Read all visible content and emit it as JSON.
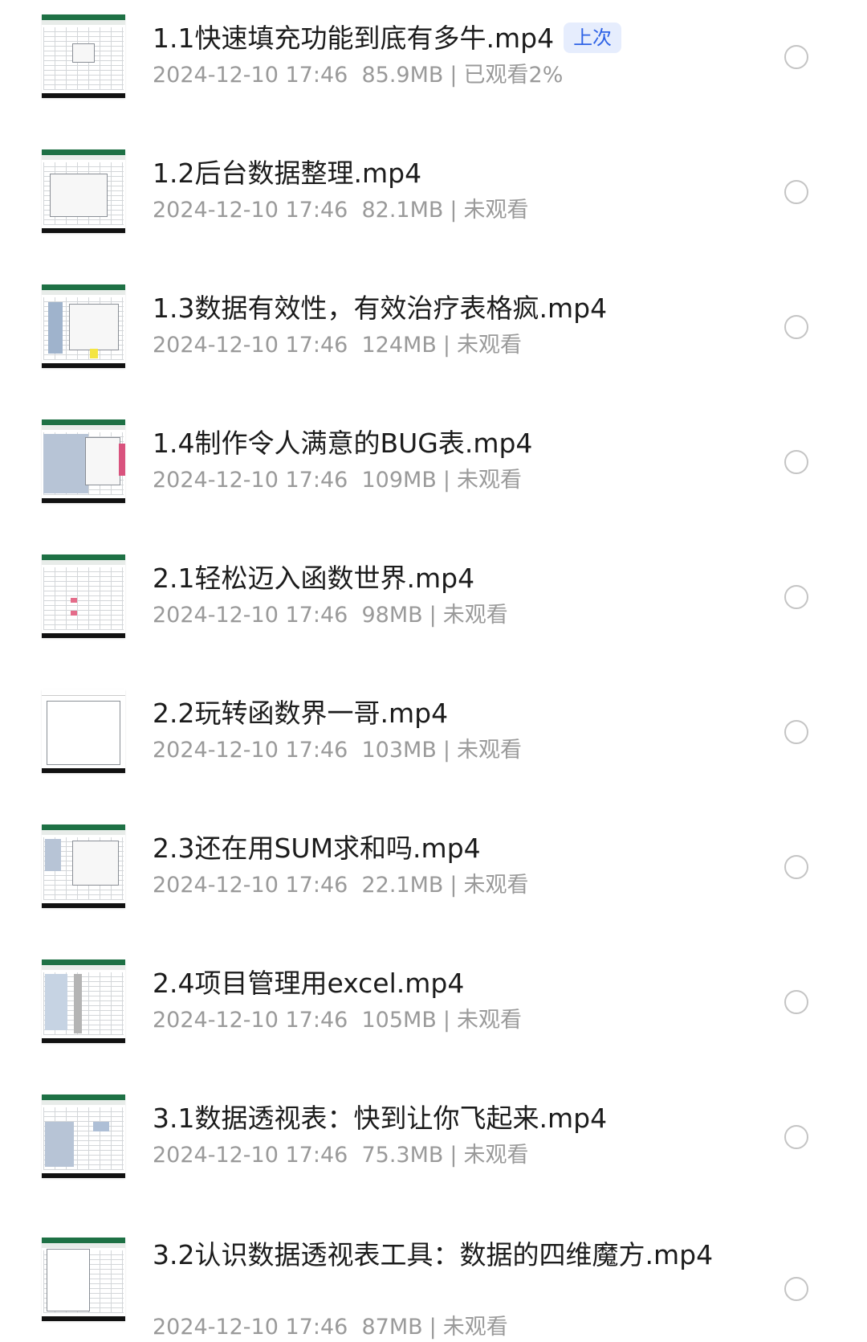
{
  "items": [
    {
      "title": "1.1快速填充功能到底有多牛.mp4",
      "badge": "上次",
      "date": "2024-12-10 17:46",
      "size": "85.9MB",
      "sep": "|",
      "status": "已观看2%"
    },
    {
      "title": "1.2后台数据整理.mp4",
      "date": "2024-12-10 17:46",
      "size": "82.1MB",
      "sep": "|",
      "status": "未观看"
    },
    {
      "title": "1.3数据有效性，有效治疗表格疯.mp4",
      "date": "2024-12-10 17:46",
      "size": "124MB",
      "sep": "|",
      "status": "未观看"
    },
    {
      "title": "1.4制作令人满意的BUG表.mp4",
      "date": "2024-12-10 17:46",
      "size": "109MB",
      "sep": "|",
      "status": "未观看"
    },
    {
      "title": "2.1轻松迈入函数世界.mp4",
      "date": "2024-12-10 17:46",
      "size": "98MB",
      "sep": "|",
      "status": "未观看"
    },
    {
      "title": "2.2玩转函数界一哥.mp4",
      "date": "2024-12-10 17:46",
      "size": "103MB",
      "sep": "|",
      "status": "未观看"
    },
    {
      "title": "2.3还在用SUM求和吗.mp4",
      "date": "2024-12-10 17:46",
      "size": "22.1MB",
      "sep": "|",
      "status": "未观看"
    },
    {
      "title": "2.4项目管理用excel.mp4",
      "date": "2024-12-10 17:46",
      "size": "105MB",
      "sep": "|",
      "status": "未观看"
    },
    {
      "title": "3.1数据透视表：快到让你飞起来.mp4",
      "date": "2024-12-10 17:46",
      "size": "75.3MB",
      "sep": "|",
      "status": "未观看"
    },
    {
      "title": "3.2认识数据透视表工具：数据的四维魔方.mp4",
      "date": "2024-12-10 17:46",
      "size": "87MB",
      "sep": "|",
      "status": "未观看"
    }
  ],
  "colors": {
    "badge_text": "#2f63e6",
    "badge_bg": "#e6edfd",
    "meta": "#9a9a9a",
    "excel_green": "#1e7145"
  },
  "icons": {
    "thumbnail": "spreadsheet-thumbnail",
    "select": "radio-circle-icon"
  }
}
